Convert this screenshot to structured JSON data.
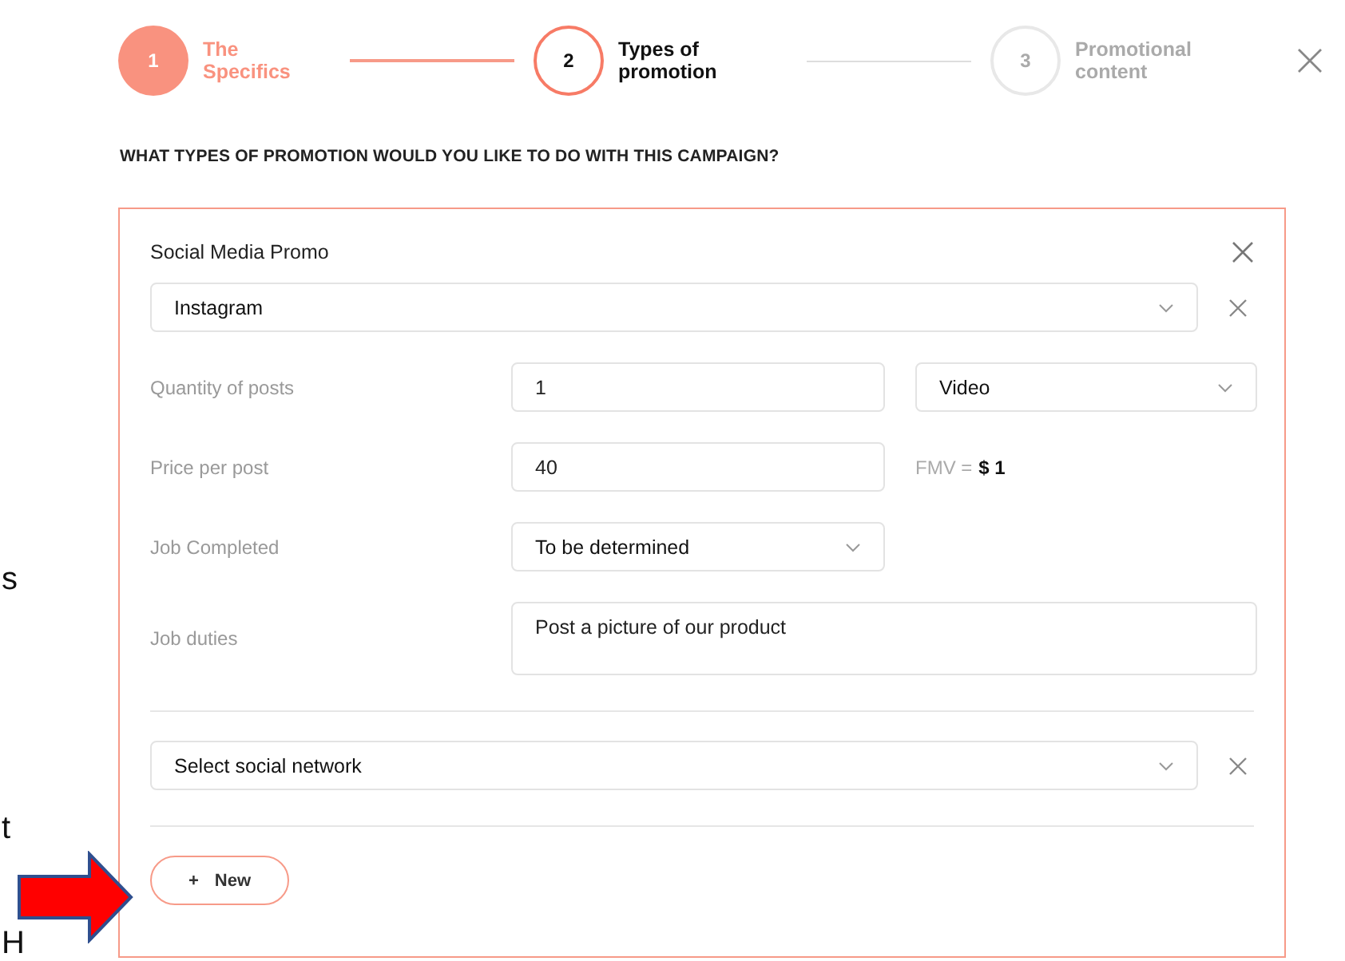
{
  "steps": [
    {
      "number": "1",
      "label": "The Specifics",
      "completed": true,
      "selected": false
    },
    {
      "number": "2",
      "label": "Types of promotion",
      "completed": false,
      "selected": true
    },
    {
      "number": "3",
      "label": "Promotional content",
      "completed": false,
      "selected": false
    }
  ],
  "question": "WHAT TYPES OF PROMOTION WOULD YOU LIKE TO DO WITH THIS CAMPAIGN?",
  "promo": {
    "title": "Social Media Promo",
    "network": {
      "value": "Instagram"
    },
    "rows": [
      {
        "kind": "pair",
        "label": "Quantity of posts",
        "value": "1",
        "select": "Video"
      },
      {
        "kind": "fmv",
        "label": "Price per post",
        "value": "40",
        "fmv_label": "FMV =",
        "fmv_value": "$ 1"
      },
      {
        "kind": "select",
        "label": "Job Completed",
        "value": "To be determined"
      },
      {
        "kind": "textarea",
        "label": "Job duties",
        "value": "Post a picture of our product"
      }
    ],
    "new_network": {
      "placeholder": "Select social network"
    },
    "new_button": {
      "icon": "+",
      "label": "New"
    }
  },
  "edge_fragments": [
    "s",
    "t",
    "H"
  ]
}
